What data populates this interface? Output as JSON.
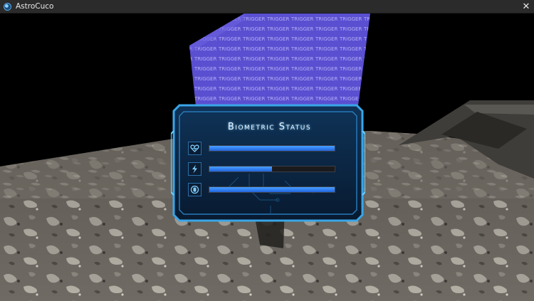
{
  "window": {
    "title": "AstroCuco",
    "close_glyph": "✕"
  },
  "scene": {
    "trigger_label": "TRIGGER"
  },
  "hud": {
    "title": "Biometric Status",
    "stats": [
      {
        "icon": "heart-shield-icon",
        "level": 1.0
      },
      {
        "icon": "lightning-icon",
        "level": 0.5
      },
      {
        "icon": "oxygen-tank-icon",
        "level": 1.0
      }
    ],
    "accent_color": "#2f7cf0",
    "frame_color": "#3aa6e8"
  }
}
